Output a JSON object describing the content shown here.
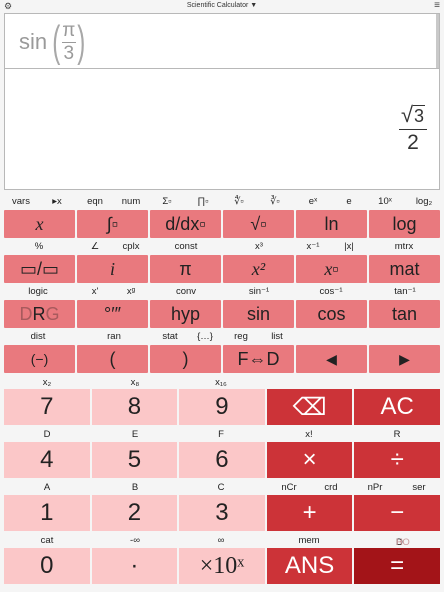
{
  "topbar": {
    "title": "Scientific Calculator ▼",
    "gear": "⚙",
    "menu": "≡"
  },
  "input": {
    "fn": "sin",
    "num": "π",
    "den": "3"
  },
  "result": {
    "radical": "√",
    "radicand": "3",
    "den": "2"
  },
  "rows": [
    {
      "labels": [
        "vars",
        "▸x",
        "eqn",
        "num",
        "Σ▫",
        "∏▫",
        "∜▫",
        "∛▫",
        "eˣ",
        "e",
        "10ˣ",
        "log₂"
      ],
      "keys": [
        "x",
        "∫▫",
        "d/dx▫",
        "√▫",
        "ln",
        "log"
      ]
    },
    {
      "labels": [
        "%",
        "∠",
        "cplx",
        "const",
        "x³",
        "x⁻¹",
        "|x|",
        "mtrx"
      ],
      "keys": [
        "▭/▭",
        "i",
        "π",
        "x²",
        "x▫",
        "mat"
      ]
    },
    {
      "labels": [
        "logic",
        "x'",
        "xᵍ",
        "conv",
        "sin⁻¹",
        "cos⁻¹",
        "tan⁻¹"
      ],
      "keys": [
        "DRG",
        "°′″",
        "hyp",
        "sin",
        "cos",
        "tan"
      ]
    },
    {
      "labels": [
        "dist",
        "ran",
        "stat",
        "{…}",
        "reg",
        "list"
      ],
      "keys": [
        "(−)",
        "(",
        ")",
        "F⇔D",
        "◀",
        "▶"
      ]
    }
  ],
  "numpad": {
    "labels": [
      [
        "x₂",
        "x₈",
        "x₁₆",
        "",
        ""
      ],
      [
        "D",
        "E",
        "F",
        "x!",
        "R"
      ],
      [
        "A",
        "B",
        "C",
        "nCr",
        "crd",
        "nPr",
        "ser"
      ],
      [
        "cat",
        "-∞",
        "∞",
        "mem",
        "BODH"
      ]
    ],
    "keys": [
      [
        "7",
        "8",
        "9",
        "⌫",
        "AC"
      ],
      [
        "4",
        "5",
        "6",
        "×",
        "÷"
      ],
      [
        "1",
        "2",
        "3",
        "+",
        "−"
      ],
      [
        "0",
        "·",
        "×10ˣ",
        "ANS",
        "="
      ]
    ]
  },
  "colors": {
    "fn_key": "#e9797e",
    "num_key": "#fbc7c8",
    "op_key": "#cc3338",
    "eq_key": "#a31418"
  }
}
